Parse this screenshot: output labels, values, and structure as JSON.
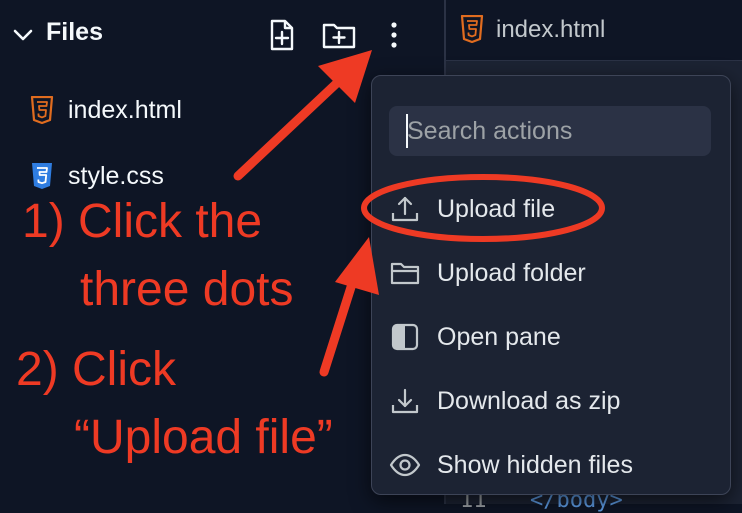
{
  "sidebar": {
    "title": "Files",
    "files": [
      {
        "name": "index.html",
        "icon": "html5-icon",
        "color": "#e06c1f"
      },
      {
        "name": "style.css",
        "icon": "css3-icon",
        "color": "#2f7de1"
      }
    ]
  },
  "editor": {
    "tab_name": "index.html",
    "line_number": "11",
    "code_fragment": "</body>"
  },
  "menu": {
    "search_placeholder": "Search actions",
    "items": [
      {
        "label": "Upload file",
        "icon": "upload-icon"
      },
      {
        "label": "Upload folder",
        "icon": "folder-icon"
      },
      {
        "label": "Open pane",
        "icon": "pane-icon"
      },
      {
        "label": "Download as zip",
        "icon": "download-icon"
      },
      {
        "label": "Show hidden files",
        "icon": "eye-icon"
      }
    ]
  },
  "annotations": {
    "step1_line1": "1) Click the",
    "step1_line2": "three dots",
    "step2_line1": "2) Click",
    "step2_line2": "“Upload file”"
  },
  "colors": {
    "background": "#0e1525",
    "annotation": "#ee3a24",
    "menu_bg": "#1c2333"
  }
}
